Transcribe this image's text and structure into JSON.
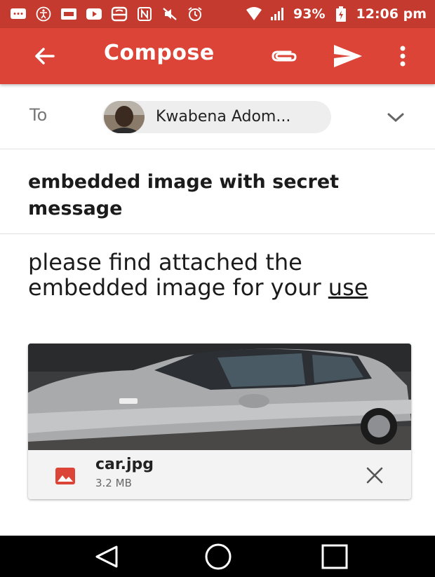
{
  "status_bar": {
    "battery": "93%",
    "time": "12:06 pm",
    "color": "#c43a2f",
    "icons": [
      "messages-icon",
      "accessibility-icon",
      "news-icon",
      "youtube-icon",
      "cast-icon",
      "nfc-icon",
      "mute-icon",
      "alarm-icon",
      "wifi-icon",
      "signal-icon",
      "battery-icon"
    ]
  },
  "app_bar": {
    "title": "Compose",
    "color": "#db4437",
    "actions": [
      "back-arrow-icon",
      "attach-icon",
      "send-icon",
      "more-vert-icon"
    ]
  },
  "to_field": {
    "label": "To",
    "recipient": "Kwabena Adom..."
  },
  "subject": {
    "text": "embedded image with secret message"
  },
  "body": {
    "line1": "please find attached the",
    "line2_pre": "embedded image for your ",
    "line2_link": "use"
  },
  "attachment": {
    "file_name": "car.jpg",
    "file_size": "3.2 MB",
    "icon": "image-icon",
    "icon_color": "#db4437"
  },
  "nav_bar": {
    "buttons": [
      "back-triangle-icon",
      "home-circle-icon",
      "recents-square-icon"
    ]
  }
}
